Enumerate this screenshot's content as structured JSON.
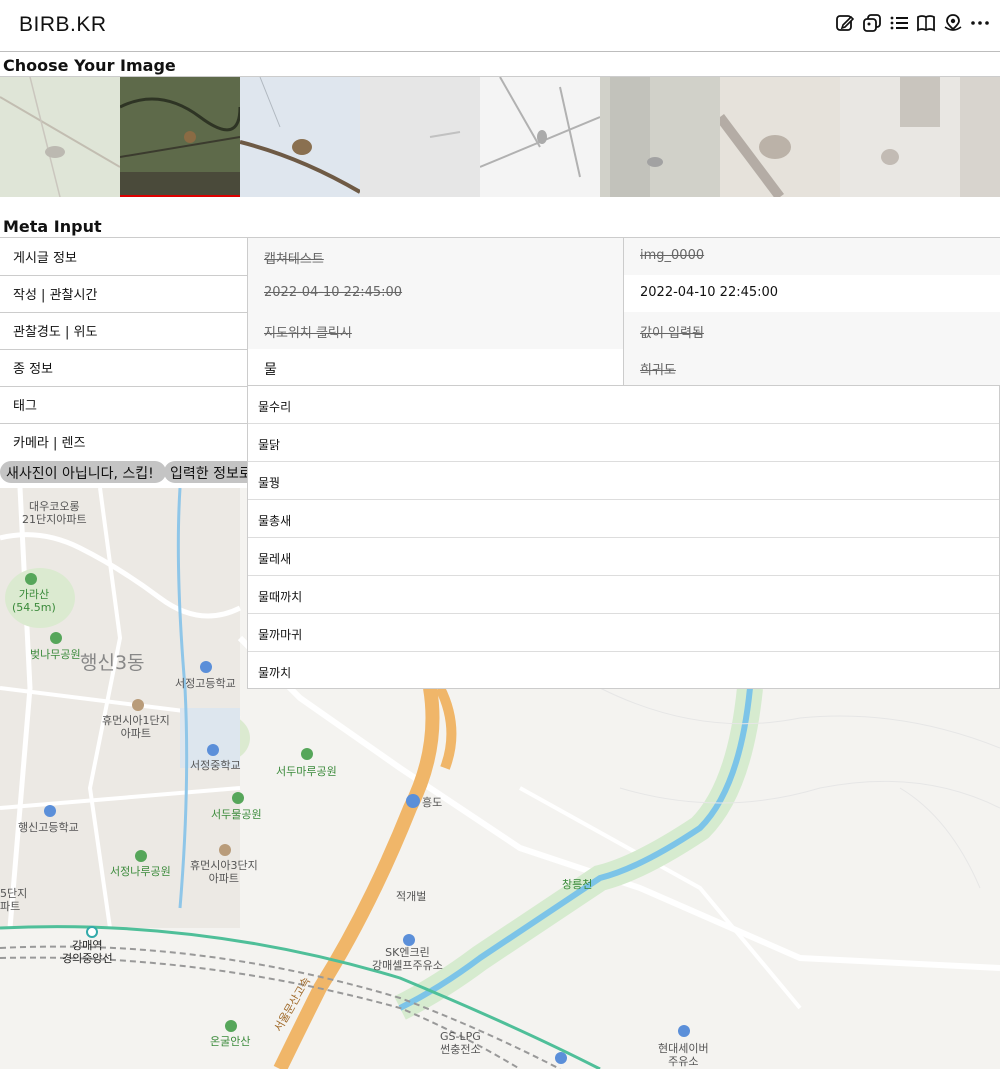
{
  "app": {
    "title": "BIRB.KR"
  },
  "header_icons": [
    "edit-icon",
    "gallery-icon",
    "list-icon",
    "book-icon",
    "map-pin-icon",
    "more-icon"
  ],
  "sections": {
    "choose_image": "Choose Your Image",
    "meta_input": "Meta Input"
  },
  "meta": {
    "rows": [
      {
        "label": "게시글 정보",
        "col1": "캡쳐테스트",
        "col2": "img_0000"
      },
      {
        "label": "작성 | 관찰시간",
        "col1": "2022-04-10 22:45:00",
        "col2": "2022-04-10 22:45:00"
      },
      {
        "label": "관찰경도 | 위도",
        "col1": "지도위치 클릭시",
        "col2": "값이 입력됨"
      },
      {
        "label": "종 정보",
        "col1": "물",
        "col2": "희귀도"
      },
      {
        "label": "태그"
      },
      {
        "label": "카메라 | 렌즈"
      }
    ]
  },
  "actions": {
    "skip": "새사진이 아닙니다, 스킵!",
    "submit": "입력한 정보로"
  },
  "dropdown": {
    "options": [
      "물수리",
      "물닭",
      "물꿩",
      "물총새",
      "물레새",
      "물때까치",
      "물까마귀",
      "물까치"
    ]
  },
  "map": {
    "labels": {
      "apt1": "대우코오롱\n21단지아파트",
      "mountain": "가라산\n(54.5m)",
      "park1": "벚나무공원",
      "district": "행신3동",
      "school1": "서정고등학교",
      "apt2": "휴먼시아1단지\n아파트",
      "school2": "서정중학교",
      "park2": "서두마루공원",
      "park3": "서두물공원",
      "school3": "행신고등학교",
      "park4": "서정나루공원",
      "apt3": "휴먼시아3단지\n아파트",
      "apt4": "5단지\n파트",
      "ic": "흥도",
      "place1": "적개벌",
      "stream": "창릉천",
      "station": "강매역\n경의중앙선",
      "gas1": "SK엔크린\n강매셀프주유소",
      "highway": "서울문산고속",
      "mountain2": "온굴안산",
      "gas2": "GS-LPG\n썬충전소",
      "gas3": "현대세이버\n주유소"
    }
  }
}
